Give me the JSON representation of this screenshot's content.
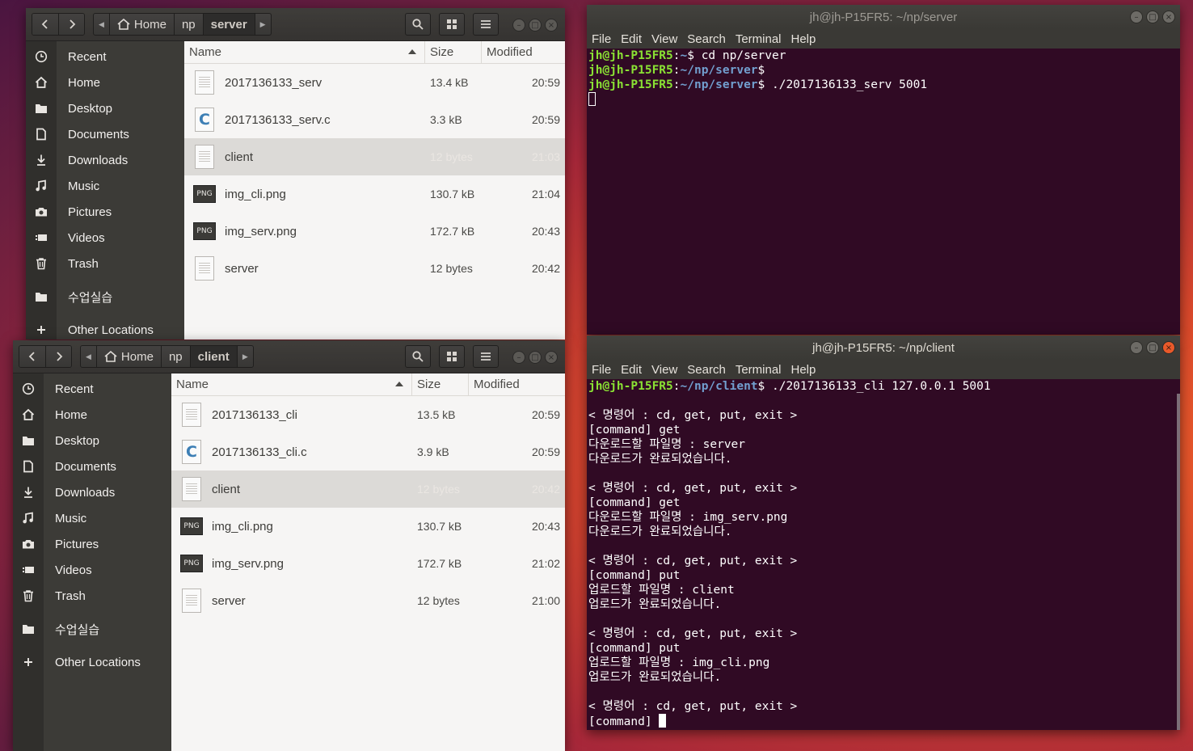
{
  "fm_server": {
    "path": {
      "home": "Home",
      "np": "np",
      "current": "server"
    },
    "columns": {
      "name": "Name",
      "size": "Size",
      "modified": "Modified"
    },
    "sidebar": [
      {
        "icon": "clock-icon",
        "label": "Recent"
      },
      {
        "icon": "home-icon",
        "label": "Home"
      },
      {
        "icon": "folder-icon",
        "label": "Desktop"
      },
      {
        "icon": "document-icon",
        "label": "Documents"
      },
      {
        "icon": "download-icon",
        "label": "Downloads"
      },
      {
        "icon": "music-icon",
        "label": "Music"
      },
      {
        "icon": "camera-icon",
        "label": "Pictures"
      },
      {
        "icon": "video-icon",
        "label": "Videos"
      },
      {
        "icon": "trash-icon",
        "label": "Trash"
      },
      {
        "icon": "folder-icon",
        "label": "수업실습"
      },
      {
        "icon": "plus-icon",
        "label": "Other Locations"
      }
    ],
    "files": [
      {
        "type": "doc",
        "name": "2017136133_serv",
        "size": "13.4 kB",
        "modified": "20:59"
      },
      {
        "type": "c",
        "name": "2017136133_serv.c",
        "size": "3.3 kB",
        "modified": "20:59"
      },
      {
        "type": "doc",
        "name": "client",
        "size": "12 bytes",
        "modified": "21:03",
        "selected": true
      },
      {
        "type": "png",
        "name": "img_cli.png",
        "size": "130.7 kB",
        "modified": "21:04"
      },
      {
        "type": "png",
        "name": "img_serv.png",
        "size": "172.7 kB",
        "modified": "20:43"
      },
      {
        "type": "doc",
        "name": "server",
        "size": "12 bytes",
        "modified": "20:42"
      }
    ]
  },
  "fm_client": {
    "path": {
      "home": "Home",
      "np": "np",
      "current": "client"
    },
    "columns": {
      "name": "Name",
      "size": "Size",
      "modified": "Modified"
    },
    "sidebar": [
      {
        "icon": "clock-icon",
        "label": "Recent"
      },
      {
        "icon": "home-icon",
        "label": "Home"
      },
      {
        "icon": "folder-icon",
        "label": "Desktop"
      },
      {
        "icon": "document-icon",
        "label": "Documents"
      },
      {
        "icon": "download-icon",
        "label": "Downloads"
      },
      {
        "icon": "music-icon",
        "label": "Music"
      },
      {
        "icon": "camera-icon",
        "label": "Pictures"
      },
      {
        "icon": "video-icon",
        "label": "Videos"
      },
      {
        "icon": "trash-icon",
        "label": "Trash"
      },
      {
        "icon": "folder-icon",
        "label": "수업실습"
      },
      {
        "icon": "plus-icon",
        "label": "Other Locations"
      }
    ],
    "files": [
      {
        "type": "doc",
        "name": "2017136133_cli",
        "size": "13.5 kB",
        "modified": "20:59"
      },
      {
        "type": "c",
        "name": "2017136133_cli.c",
        "size": "3.9 kB",
        "modified": "20:59"
      },
      {
        "type": "doc",
        "name": "client",
        "size": "12 bytes",
        "modified": "20:42",
        "selected": true
      },
      {
        "type": "png",
        "name": "img_cli.png",
        "size": "130.7 kB",
        "modified": "20:43"
      },
      {
        "type": "png",
        "name": "img_serv.png",
        "size": "172.7 kB",
        "modified": "21:02"
      },
      {
        "type": "doc",
        "name": "server",
        "size": "12 bytes",
        "modified": "21:00"
      }
    ]
  },
  "term_server": {
    "title": "jh@jh-P15FR5: ~/np/server",
    "menu": [
      "File",
      "Edit",
      "View",
      "Search",
      "Terminal",
      "Help"
    ],
    "lines": [
      {
        "user": "jh@jh-P15FR5",
        "path": "~",
        "cmd": " cd np/server"
      },
      {
        "user": "jh@jh-P15FR5",
        "path": "~/np/server",
        "cmd": ""
      },
      {
        "user": "jh@jh-P15FR5",
        "path": "~/np/server",
        "cmd": " ./2017136133_serv 5001"
      }
    ]
  },
  "term_client": {
    "title": "jh@jh-P15FR5: ~/np/client",
    "menu": [
      "File",
      "Edit",
      "View",
      "Search",
      "Terminal",
      "Help"
    ],
    "prompt": {
      "user": "jh@jh-P15FR5",
      "path": "~/np/client",
      "cmd": " ./2017136133_cli 127.0.0.1 5001"
    },
    "output": [
      "",
      "< 명령어 : cd, get, put, exit >",
      "[command] get",
      "다운로드할 파일명 : server",
      "다운로드가 완료되었습니다.",
      "",
      "< 명령어 : cd, get, put, exit >",
      "[command] get",
      "다운로드할 파일명 : img_serv.png",
      "다운로드가 완료되었습니다.",
      "",
      "< 명령어 : cd, get, put, exit >",
      "[command] put",
      "업로드할 파일명 : client",
      "업로드가 완료되었습니다.",
      "",
      "< 명령어 : cd, get, put, exit >",
      "[command] put",
      "업로드할 파일명 : img_cli.png",
      "업로드가 완료되었습니다.",
      "",
      "< 명령어 : cd, get, put, exit >"
    ],
    "last_line": "[command] "
  }
}
